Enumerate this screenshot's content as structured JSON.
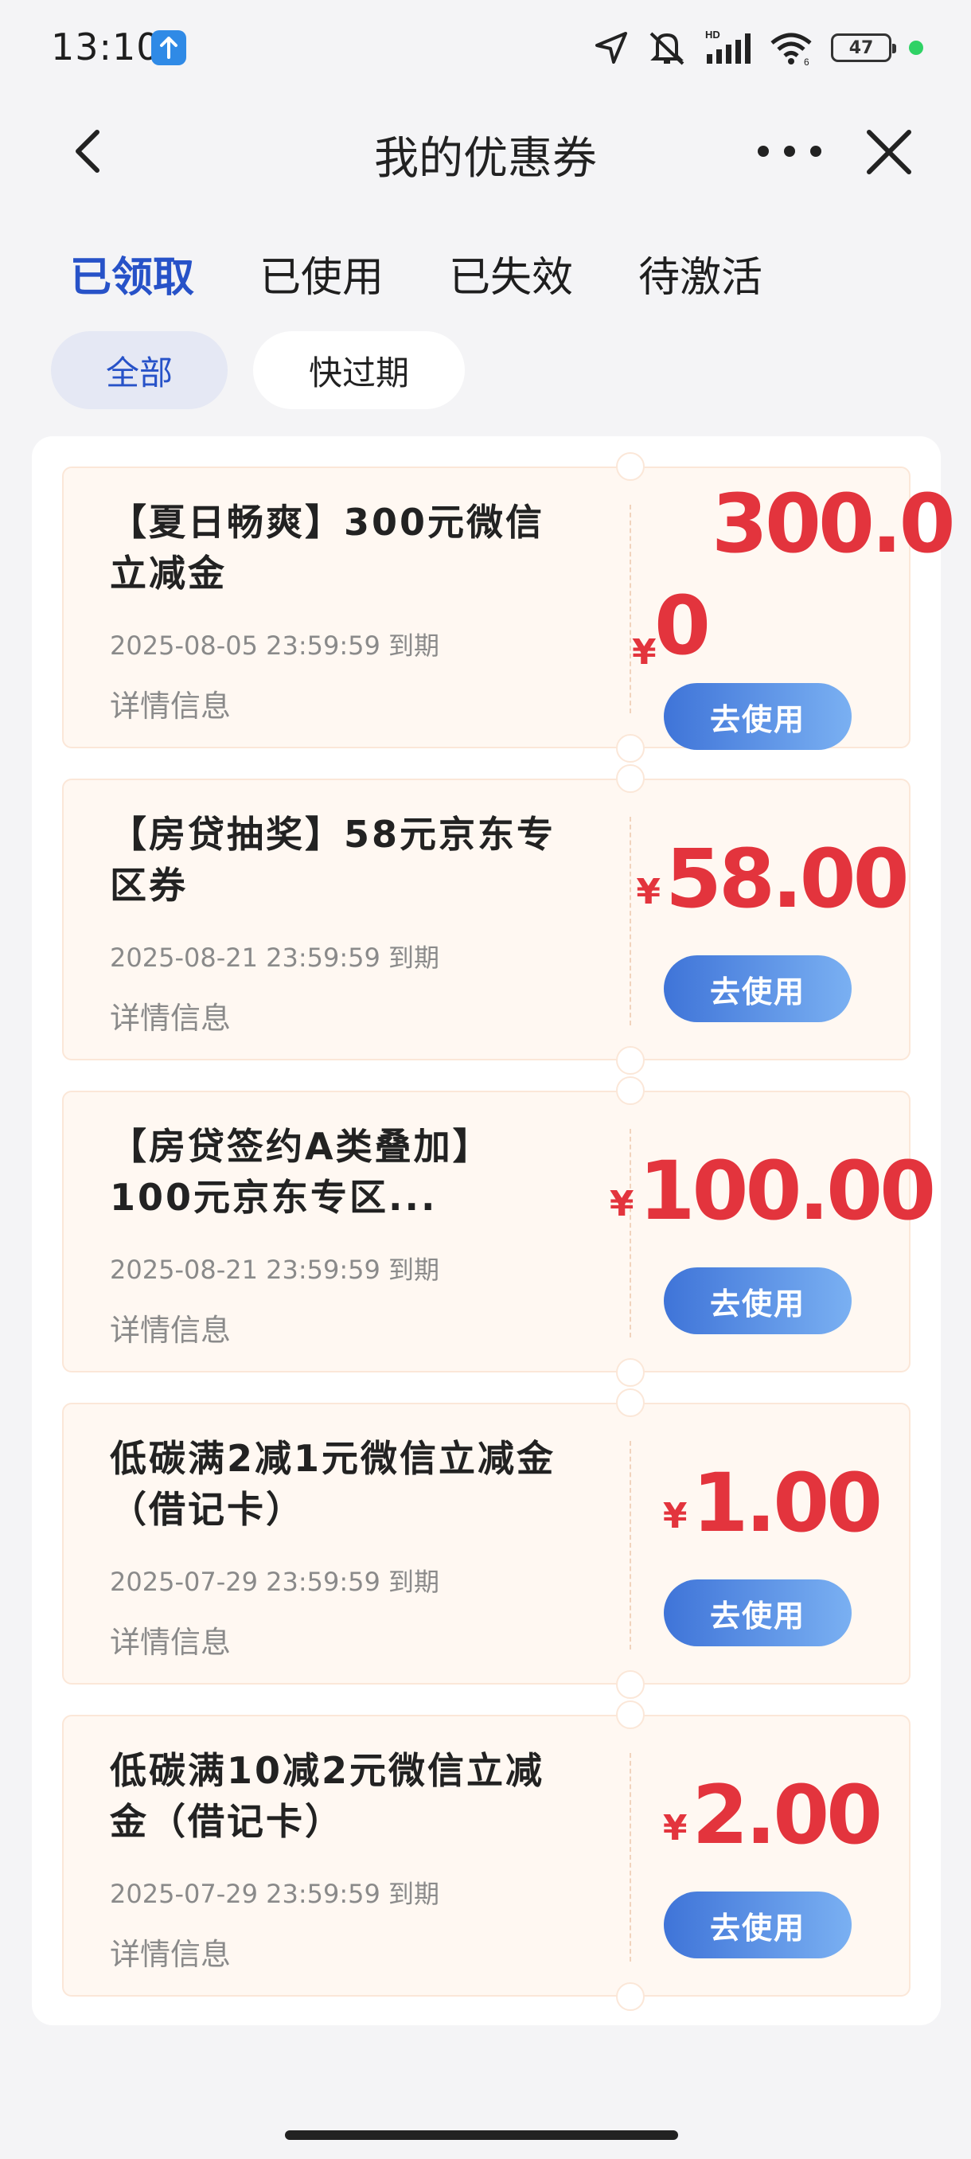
{
  "status_bar": {
    "time": "13:10",
    "battery": "47",
    "icons": [
      "upload-icon",
      "location-icon",
      "mute-icon",
      "signal-icon",
      "wifi-icon",
      "battery-icon"
    ]
  },
  "header": {
    "title": "我的优惠券"
  },
  "tabs": [
    {
      "label": "已领取",
      "active": true
    },
    {
      "label": "已使用",
      "active": false
    },
    {
      "label": "已失效",
      "active": false
    },
    {
      "label": "待激活",
      "active": false
    }
  ],
  "filters": [
    {
      "label": "全部",
      "active": true
    },
    {
      "label": "快过期",
      "active": false
    }
  ],
  "coupons": [
    {
      "title": "【夏日畅爽】300元微信立减金",
      "expiry": "2025-08-05 23:59:59 到期",
      "detail": "详情信息",
      "currency": "¥",
      "amount_line1": "300.0",
      "amount_line2": "0",
      "button": "去使用"
    },
    {
      "title": "【房贷抽奖】58元京东专区券",
      "expiry": "2025-08-21 23:59:59 到期",
      "detail": "详情信息",
      "currency": "¥",
      "amount": "58.00",
      "button": "去使用"
    },
    {
      "title": "【房贷签约A类叠加】100元京东专区...",
      "expiry": "2025-08-21 23:59:59 到期",
      "detail": "详情信息",
      "currency": "¥",
      "amount": "100.00",
      "button": "去使用"
    },
    {
      "title": "低碳满2减1元微信立减金（借记卡）",
      "expiry": "2025-07-29 23:59:59 到期",
      "detail": "详情信息",
      "currency": "¥",
      "amount": "1.00",
      "button": "去使用"
    },
    {
      "title": "低碳满10减2元微信立减金（借记卡）",
      "expiry": "2025-07-29 23:59:59 到期",
      "detail": "详情信息",
      "currency": "¥",
      "amount": "2.00",
      "button": "去使用"
    }
  ],
  "colors": {
    "accent": "#2752c8",
    "price": "#e3343d",
    "button_start": "#3f74d8",
    "button_end": "#7ab0f2",
    "coupon_bg": "#fff8f2"
  }
}
